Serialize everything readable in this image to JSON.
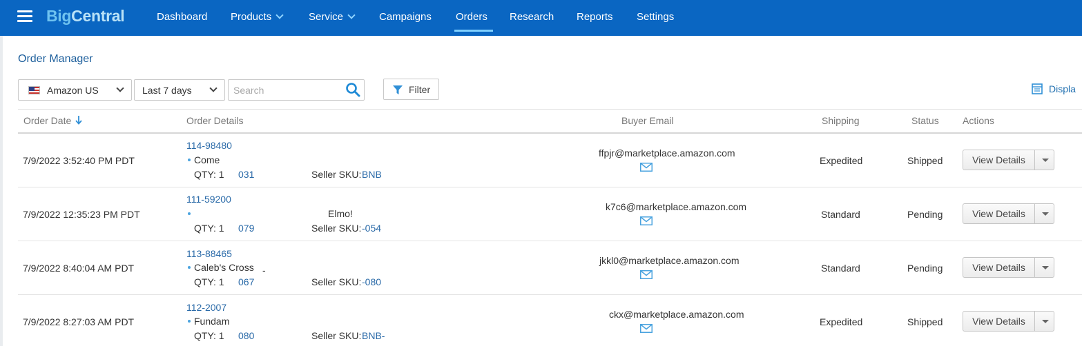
{
  "header": {
    "brand_big": "Big",
    "brand_central": "Central",
    "nav": [
      "Dashboard",
      "Products",
      "Service",
      "Campaigns",
      "Orders",
      "Research",
      "Reports",
      "Settings"
    ],
    "active_nav": "Orders"
  },
  "page": {
    "title": "Order Manager"
  },
  "toolbar": {
    "marketplace": "Amazon US",
    "date_range": "Last 7 days",
    "search_placeholder": "Search",
    "filter_label": "Filter",
    "display_label": "Displa"
  },
  "table": {
    "columns": [
      "Order Date",
      "Order Details",
      "Buyer Email",
      "Shipping",
      "Status",
      "Actions"
    ],
    "view_details_label": "View Details",
    "rows": [
      {
        "date": "7/9/2022 3:52:40 PM PDT",
        "order_id": "114-98480",
        "product": "Come",
        "product_extra": "",
        "qty": "QTY: 1",
        "asin": "031",
        "sku_label": "Seller SKU:",
        "sku": "BNB",
        "email": "ffpjr@marketplace.amazon.com",
        "shipping": "Expedited",
        "status": "Shipped"
      },
      {
        "date": "7/9/2022 12:35:23 PM PDT",
        "order_id": "111-59200",
        "product": "",
        "product_extra": "Elmo!",
        "qty": "QTY: 1",
        "asin": "079",
        "sku_label": "Seller SKU:",
        "sku": "-054",
        "email": "k7c6@marketplace.amazon.com",
        "shipping": "Standard",
        "status": "Pending"
      },
      {
        "date": "7/9/2022 8:40:04 AM PDT",
        "order_id": "113-88465",
        "product": "Caleb's Cross",
        "product_extra": "-",
        "qty": "QTY: 1",
        "asin": "067",
        "sku_label": "Seller SKU:",
        "sku": "-080",
        "email": "jkkl0@marketplace.amazon.com",
        "shipping": "Standard",
        "status": "Pending"
      },
      {
        "date": "7/9/2022 8:27:03 AM PDT",
        "order_id": "112-2007",
        "product": "Fundam",
        "product_extra": "",
        "qty": "QTY: 1",
        "asin": "080",
        "sku_label": "Seller SKU:",
        "sku": "BNB-",
        "email": "ckx@marketplace.amazon.com",
        "shipping": "Expedited",
        "status": "Shipped"
      }
    ]
  },
  "colors": {
    "header_bg": "#0a66c2",
    "link": "#2a6aa8",
    "accent": "#4aa3df"
  }
}
